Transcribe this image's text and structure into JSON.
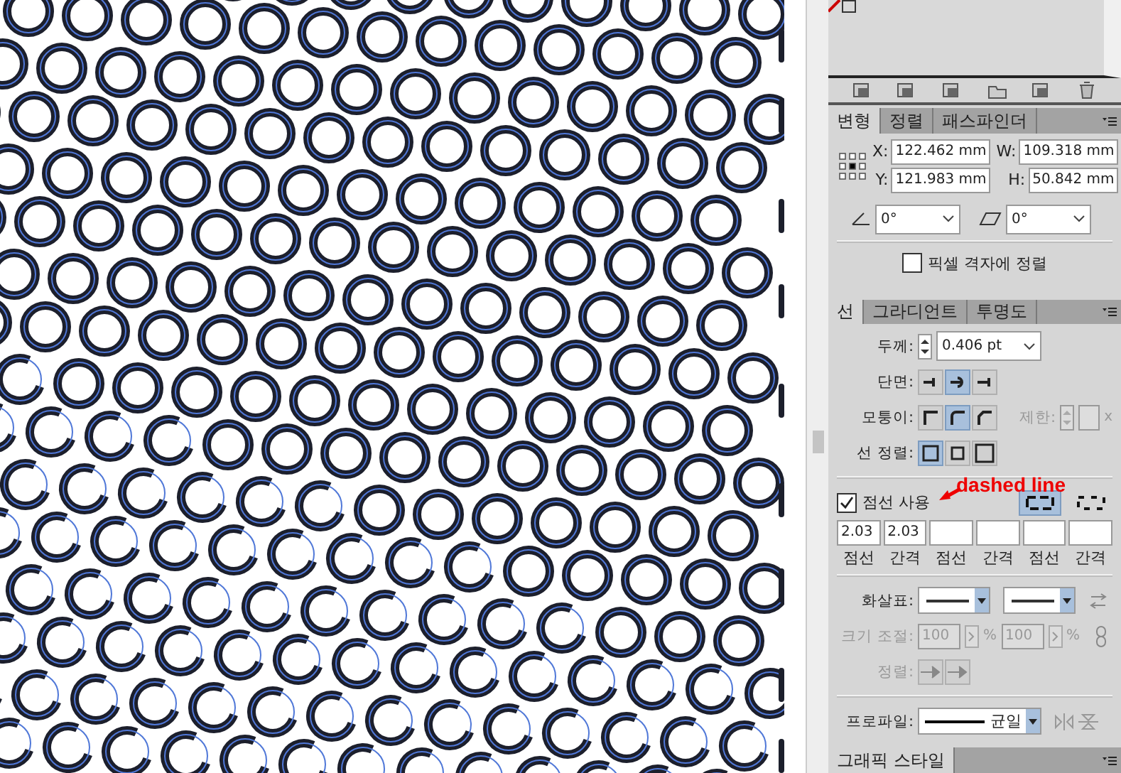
{
  "transform_panel": {
    "tabs": [
      {
        "label": "변형",
        "selected": true
      },
      {
        "label": "정렬",
        "selected": false
      },
      {
        "label": "패스파인더",
        "selected": false
      }
    ],
    "fields": [
      {
        "label": "X:",
        "value": "122.462 mm"
      },
      {
        "label": "W:",
        "value": "109.318 mm"
      },
      {
        "label": "Y:",
        "value": "121.983 mm"
      },
      {
        "label": "H:",
        "value": "50.842 mm"
      }
    ],
    "rotate": {
      "value": "0°"
    },
    "shear": {
      "value": "0°"
    },
    "pixel_align": {
      "label": "픽셀 격자에 정렬",
      "checked": false
    }
  },
  "stroke_panel": {
    "tabs": [
      {
        "label": "선",
        "selected": true
      },
      {
        "label": "그라디언트",
        "selected": false
      },
      {
        "label": "투명도",
        "selected": false
      }
    ],
    "weight": {
      "label": "두께:",
      "value": "0.406 pt"
    },
    "cap": {
      "label": "단면:",
      "buttons": [
        {
          "kind": "butt",
          "selected": false
        },
        {
          "kind": "round",
          "selected": true
        },
        {
          "kind": "square",
          "selected": false
        }
      ]
    },
    "corner": {
      "label": "모퉁이:",
      "buttons": [
        {
          "kind": "miter",
          "selected": false
        },
        {
          "kind": "round",
          "selected": true
        },
        {
          "kind": "bevel",
          "selected": false
        }
      ]
    },
    "limit": {
      "label": "제한:",
      "unit": "x",
      "disabled": true
    },
    "align": {
      "label": "선 정렬:",
      "buttons": [
        {
          "kind": "center",
          "selected": true
        },
        {
          "kind": "inside",
          "selected": false
        },
        {
          "kind": "outside",
          "selected": false
        }
      ]
    },
    "dashed": {
      "label": "점선 사용",
      "checked": true
    },
    "annotation": "dashed line",
    "dash_styles": [
      {
        "selected": true
      },
      {
        "selected": false
      }
    ],
    "dash_fields": [
      {
        "value": "2.03",
        "caption": "점선"
      },
      {
        "value": "2.03",
        "caption": "간격"
      },
      {
        "caption": "점선"
      },
      {
        "caption": "간격"
      },
      {
        "caption": "점선"
      },
      {
        "caption": "간격"
      }
    ],
    "arrowheads": {
      "label": "화살표:"
    },
    "scale": {
      "label": "크기 조절:",
      "values": [
        "100",
        "100"
      ],
      "unit": "%",
      "disabled": true
    },
    "arrow_align": {
      "label": "정렬:",
      "disabled": true
    },
    "profile": {
      "label": "프로파일:",
      "value": "균일"
    }
  },
  "graphic_styles": {
    "tabs": [
      {
        "label": "그래픽 스타일",
        "selected": true
      }
    ]
  }
}
